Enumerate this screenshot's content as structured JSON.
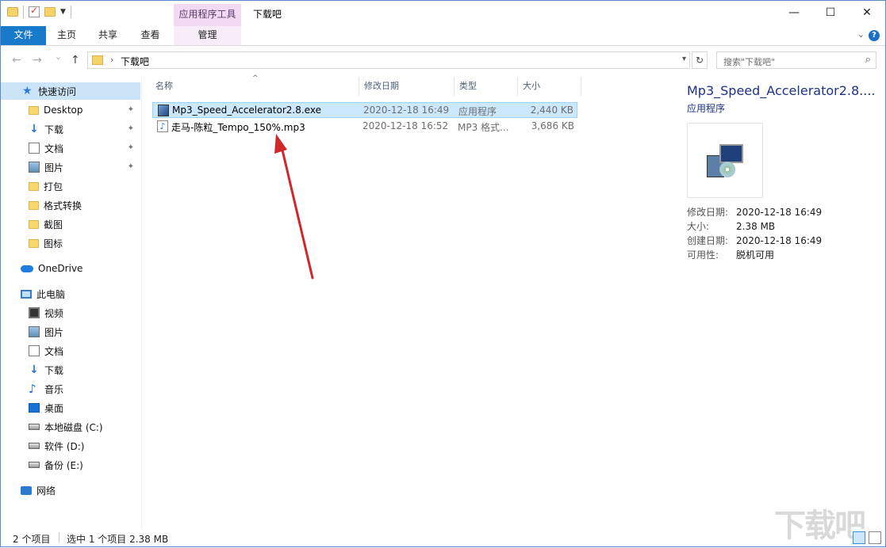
{
  "titlebar": {
    "context_tab": "应用程序工具",
    "title": "下载吧",
    "minimize": "—",
    "maximize": "☐",
    "close": "✕"
  },
  "ribbon": {
    "tabs": [
      "文件",
      "主页",
      "共享",
      "查看",
      "管理"
    ],
    "accent": "#1979ca"
  },
  "address": {
    "back": "←",
    "forward": "→",
    "recent": "⌄",
    "up": "↑",
    "path": "下载吧",
    "refresh": "↻",
    "search_placeholder": "搜索\"下载吧\""
  },
  "navpane": {
    "quick_access": "快速访问",
    "items": [
      {
        "label": "Desktop",
        "icon": "folder-icon"
      },
      {
        "label": "下载",
        "icon": "download-icon"
      },
      {
        "label": "文档",
        "icon": "document-icon"
      },
      {
        "label": "图片",
        "icon": "picture-icon"
      },
      {
        "label": "打包",
        "icon": "folder-icon"
      },
      {
        "label": "格式转换",
        "icon": "folder-icon"
      },
      {
        "label": "截图",
        "icon": "folder-icon"
      },
      {
        "label": "图标",
        "icon": "folder-icon"
      }
    ],
    "onedrive": "OneDrive",
    "this_pc": "此电脑",
    "pc_items": [
      {
        "label": "视频",
        "icon": "video-icon"
      },
      {
        "label": "图片",
        "icon": "picture-icon"
      },
      {
        "label": "文档",
        "icon": "document-icon"
      },
      {
        "label": "下载",
        "icon": "download-icon"
      },
      {
        "label": "音乐",
        "icon": "music-icon"
      },
      {
        "label": "桌面",
        "icon": "desktop-icon"
      },
      {
        "label": "本地磁盘 (C:)",
        "icon": "drive-icon"
      },
      {
        "label": "软件 (D:)",
        "icon": "drive-icon"
      },
      {
        "label": "备份 (E:)",
        "icon": "drive-icon"
      }
    ],
    "network": "网络"
  },
  "filelist": {
    "columns": {
      "name": "名称",
      "modified": "修改日期",
      "type": "类型",
      "size": "大小"
    },
    "files": [
      {
        "name": "Mp3_Speed_Accelerator2.8.exe",
        "modified": "2020-12-18 16:49",
        "type": "应用程序",
        "size": "2,440 KB",
        "selected": true
      },
      {
        "name": "走马-陈粒_Tempo_150%.mp3",
        "modified": "2020-12-18 16:52",
        "type": "MP3 格式...",
        "size": "3,686 KB",
        "selected": false
      }
    ]
  },
  "preview": {
    "title": "Mp3_Speed_Accelerator2.8....",
    "type": "应用程序",
    "meta": [
      {
        "key": "修改日期:",
        "value": "2020-12-18 16:49"
      },
      {
        "key": "大小:",
        "value": "2.38 MB"
      },
      {
        "key": "创建日期:",
        "value": "2020-12-18 16:49"
      },
      {
        "key": "可用性:",
        "value": "脱机可用"
      }
    ]
  },
  "status": {
    "count": "2 个项目",
    "selected": "选中 1 个项目  2.38 MB"
  },
  "watermark": "下载吧"
}
